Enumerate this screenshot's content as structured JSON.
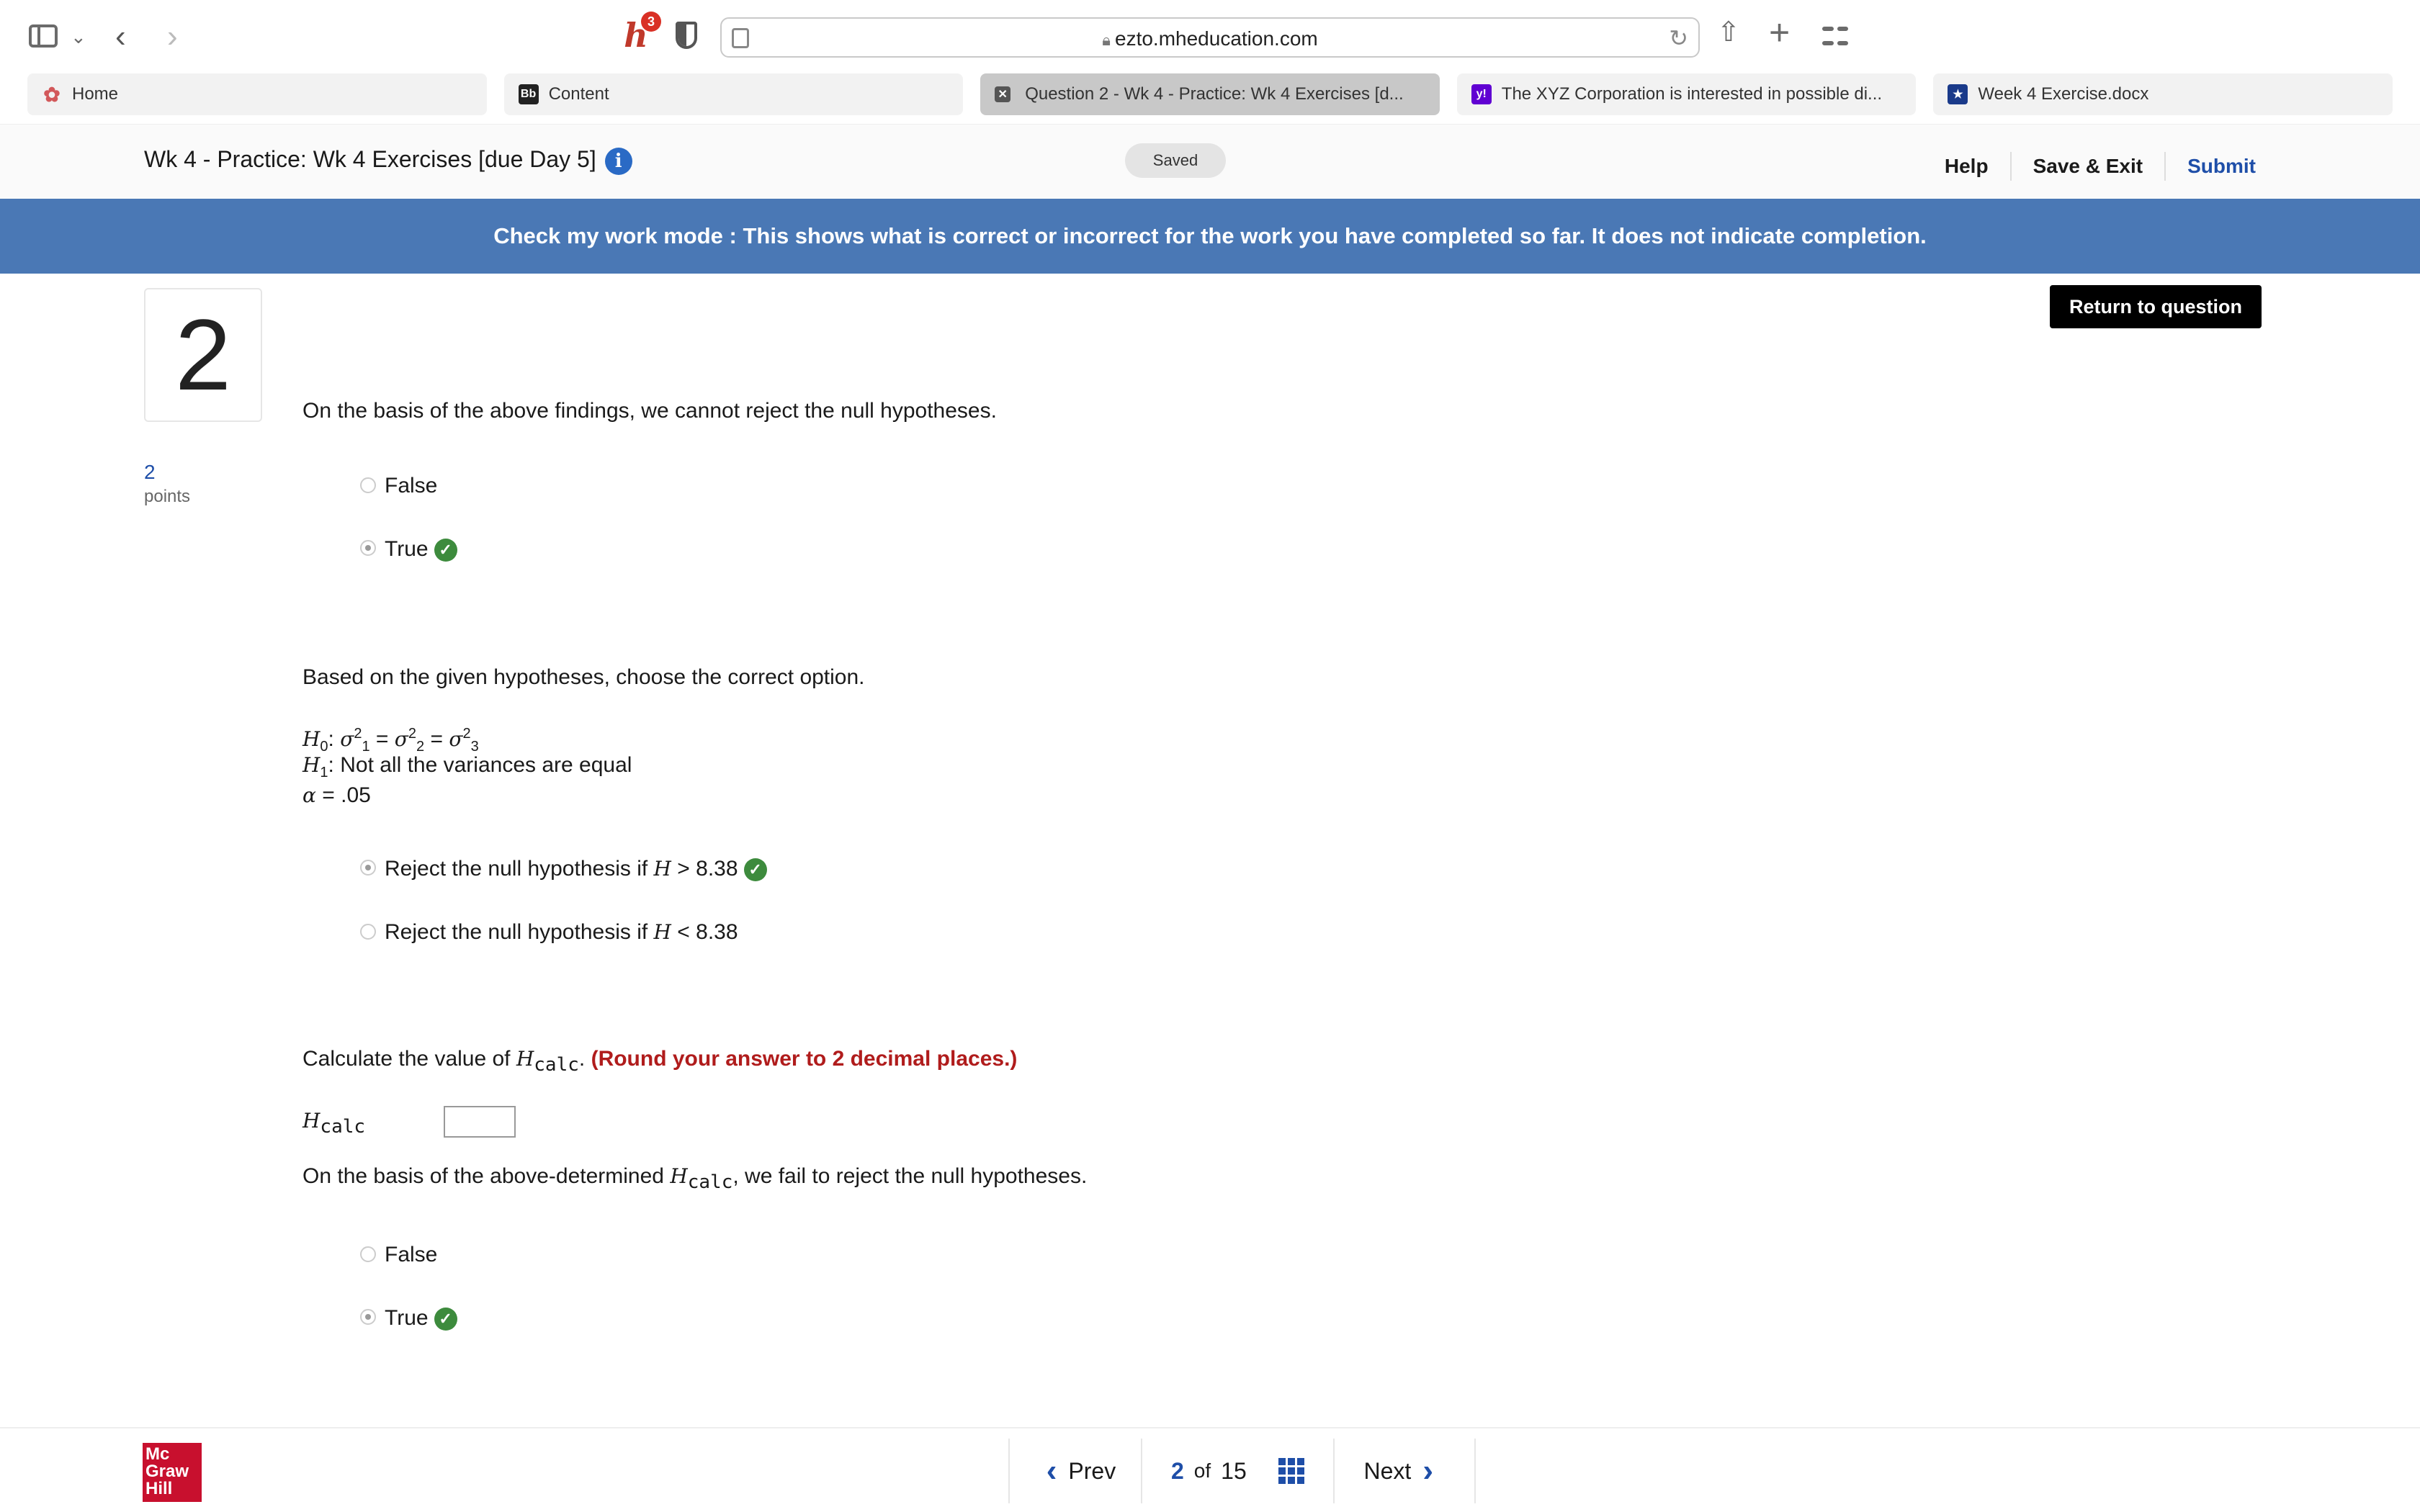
{
  "browser": {
    "url": "ezto.mheducation.com",
    "honey_badge": "3",
    "tabs": [
      {
        "label": "Home",
        "icon": "mcgraw-hill-bird-icon"
      },
      {
        "label": "Content",
        "icon": "blackboard-icon",
        "icon_text": "Bb"
      },
      {
        "label": "Question 2 - Wk 4 - Practice: Wk 4 Exercises [d...",
        "icon": "close-icon",
        "active": true
      },
      {
        "label": "The XYZ Corporation is interested in possible di...",
        "icon": "yahoo-icon",
        "icon_text": "y!"
      },
      {
        "label": "Week 4 Exercise.docx",
        "icon": "doc-star-icon"
      }
    ]
  },
  "header": {
    "title": "Wk 4 - Practice: Wk 4 Exercises [due Day 5]",
    "saved": "Saved",
    "help": "Help",
    "save_exit": "Save & Exit",
    "submit": "Submit"
  },
  "banner": "Check my work mode : This shows what is correct or incorrect for the work you have completed so far. It does not indicate completion.",
  "question": {
    "number": "2",
    "points_value": "2",
    "points_label": "points",
    "return_button": "Return to question",
    "part1": {
      "prompt": "On the basis of the above findings, we cannot reject the null hypotheses.",
      "options": [
        {
          "label": "False",
          "selected": false,
          "correct": false
        },
        {
          "label": "True",
          "selected": true,
          "correct": true
        }
      ]
    },
    "part2": {
      "prompt": "Based on the given hypotheses, choose the correct option.",
      "h1_text": ": Not all the variances are equal",
      "alpha_text": "= .05",
      "options": [
        {
          "label_before": "Reject the null hypothesis if ",
          "var": "H",
          "label_after": " > 8.38",
          "selected": true,
          "correct": true
        },
        {
          "label_before": "Reject the null hypothesis if ",
          "var": "H",
          "label_after": " < 8.38",
          "selected": false,
          "correct": false
        }
      ]
    },
    "part3": {
      "prompt_before": "Calculate the value of ",
      "prompt_after": ". ",
      "note": "(Round your answer to 2 decimal places.)",
      "input_label_sub": "calc",
      "input_value": ""
    },
    "part4": {
      "prompt_before": "On the basis of the above-determined ",
      "prompt_after": ", we fail to reject the null hypotheses.",
      "options": [
        {
          "label": "False",
          "selected": false,
          "correct": false
        },
        {
          "label": "True",
          "selected": true,
          "correct": true
        }
      ]
    }
  },
  "footer": {
    "logo": [
      "Mc",
      "Graw",
      "Hill"
    ],
    "prev": "Prev",
    "current": "2",
    "of": "of",
    "total": "15",
    "next": "Next"
  },
  "colors": {
    "banner": "#4a78b5",
    "accent": "#1e4ea8",
    "correct": "#3d8b3d",
    "note": "#b01c1c",
    "brand": "#c8102e"
  }
}
